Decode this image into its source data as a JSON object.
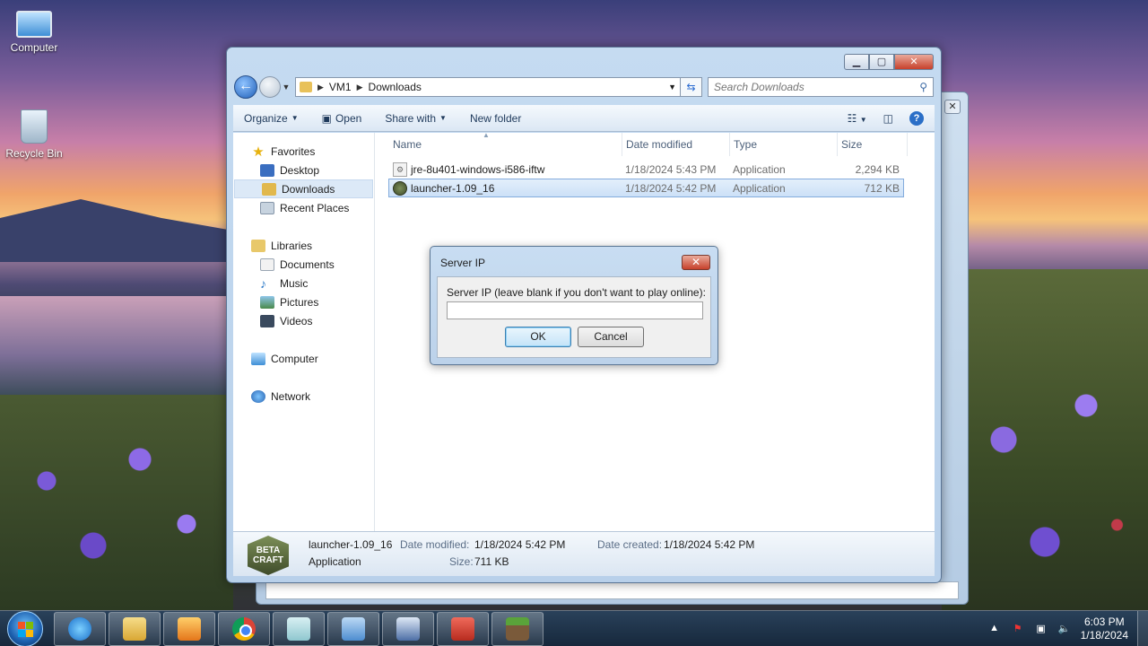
{
  "desktop": {
    "icons": [
      {
        "label": "Computer"
      },
      {
        "label": "Recycle Bin"
      }
    ]
  },
  "explorer": {
    "breadcrumb": [
      "VM1",
      "Downloads"
    ],
    "search_placeholder": "Search Downloads",
    "toolbar": {
      "organize": "Organize",
      "open": "Open",
      "share_with": "Share with",
      "new_folder": "New folder"
    },
    "nav": {
      "favorites": "Favorites",
      "desktop": "Desktop",
      "downloads": "Downloads",
      "recent_places": "Recent Places",
      "libraries": "Libraries",
      "documents": "Documents",
      "music": "Music",
      "pictures": "Pictures",
      "videos": "Videos",
      "computer": "Computer",
      "network": "Network"
    },
    "columns": {
      "name": "Name",
      "date_modified": "Date modified",
      "type": "Type",
      "size": "Size"
    },
    "files": [
      {
        "name": "jre-8u401-windows-i586-iftw",
        "date": "1/18/2024 5:43 PM",
        "type": "Application",
        "size": "2,294 KB"
      },
      {
        "name": "launcher-1.09_16",
        "date": "1/18/2024 5:42 PM",
        "type": "Application",
        "size": "712 KB"
      }
    ],
    "details": {
      "name": "launcher-1.09_16",
      "type": "Application",
      "date_modified_label": "Date modified:",
      "date_modified": "1/18/2024 5:42 PM",
      "date_created_label": "Date created:",
      "date_created": "1/18/2024 5:42 PM",
      "size_label": "Size:",
      "size": "711 KB",
      "thumb_text": "BETA CRAFT"
    }
  },
  "dialog": {
    "title": "Server IP",
    "prompt": "Server IP (leave blank if you don't want to play online):",
    "value": "",
    "ok": "OK",
    "cancel": "Cancel"
  },
  "taskbar": {
    "time": "6:03 PM",
    "date": "1/18/2024"
  }
}
